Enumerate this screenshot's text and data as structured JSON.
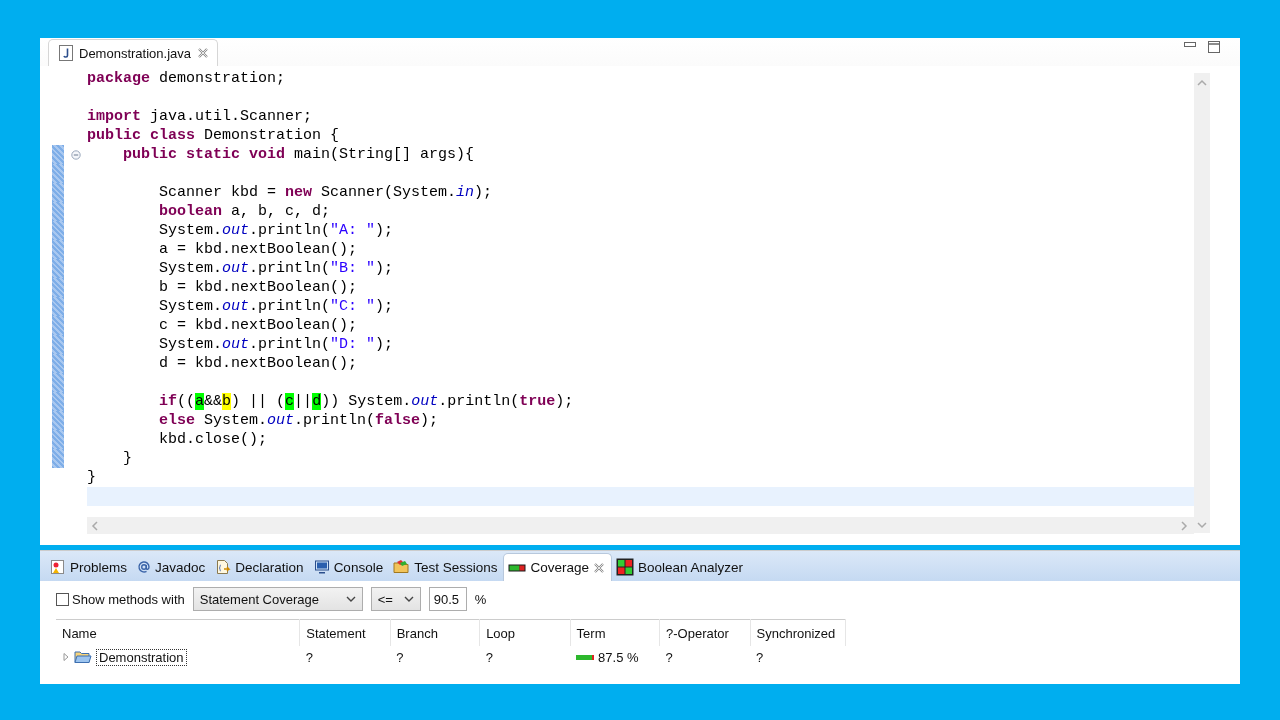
{
  "editor": {
    "tab": {
      "title": "Demonstration.java",
      "selected": true
    },
    "lines": [
      {
        "marked": false,
        "tokens": [
          {
            "kind": "keyword",
            "text": "package"
          },
          {
            "kind": "plain",
            "text": " demonstration;"
          }
        ]
      },
      {
        "marked": false,
        "blank_before": true,
        "tokens": [
          {
            "kind": "keyword",
            "text": "import"
          },
          {
            "kind": "plain",
            "text": " java.util.Scanner;"
          }
        ]
      },
      {
        "marked": false,
        "tokens": [
          {
            "kind": "keyword",
            "text": "public class"
          },
          {
            "kind": "plain",
            "text": " Demonstration {"
          }
        ]
      },
      {
        "marked": true,
        "foldable": true,
        "tokens": [
          {
            "kind": "keyword",
            "text": "    public static void"
          },
          {
            "kind": "plain",
            "text": " main(String[] args){"
          }
        ]
      },
      {
        "marked": true
      },
      {
        "marked": true,
        "tokens": [
          {
            "kind": "plain",
            "text": "        Scanner kbd = "
          },
          {
            "kind": "keyword",
            "text": "new"
          },
          {
            "kind": "plain",
            "text": " Scanner(System."
          },
          {
            "kind": "field",
            "text": "in"
          },
          {
            "kind": "plain",
            "text": ");"
          }
        ]
      },
      {
        "marked": true,
        "tokens": [
          {
            "kind": "keyword",
            "text": "        boolean"
          },
          {
            "kind": "plain",
            "text": " a, b, c, d;"
          }
        ]
      },
      {
        "marked": true,
        "tokens": [
          {
            "kind": "plain",
            "text": "        System."
          },
          {
            "kind": "field",
            "text": "out"
          },
          {
            "kind": "plain",
            "text": ".println("
          },
          {
            "kind": "string",
            "text": "\"A: \""
          },
          {
            "kind": "plain",
            "text": ");"
          }
        ]
      },
      {
        "marked": true,
        "tokens": [
          {
            "kind": "plain",
            "text": "        a = kbd.nextBoolean();"
          }
        ]
      },
      {
        "marked": true,
        "tokens": [
          {
            "kind": "plain",
            "text": "        System."
          },
          {
            "kind": "field",
            "text": "out"
          },
          {
            "kind": "plain",
            "text": ".println("
          },
          {
            "kind": "string",
            "text": "\"B: \""
          },
          {
            "kind": "plain",
            "text": ");"
          }
        ]
      },
      {
        "marked": true,
        "tokens": [
          {
            "kind": "plain",
            "text": "        b = kbd.nextBoolean();"
          }
        ]
      },
      {
        "marked": true,
        "tokens": [
          {
            "kind": "plain",
            "text": "        System."
          },
          {
            "kind": "field",
            "text": "out"
          },
          {
            "kind": "plain",
            "text": ".println("
          },
          {
            "kind": "string",
            "text": "\"C: \""
          },
          {
            "kind": "plain",
            "text": ");"
          }
        ]
      },
      {
        "marked": true,
        "tokens": [
          {
            "kind": "plain",
            "text": "        c = kbd.nextBoolean();"
          }
        ]
      },
      {
        "marked": true,
        "tokens": [
          {
            "kind": "plain",
            "text": "        System."
          },
          {
            "kind": "field",
            "text": "out"
          },
          {
            "kind": "plain",
            "text": ".println("
          },
          {
            "kind": "string",
            "text": "\"D: \""
          },
          {
            "kind": "plain",
            "text": ");"
          }
        ]
      },
      {
        "marked": true,
        "tokens": [
          {
            "kind": "plain",
            "text": "        d = kbd.nextBoolean();"
          }
        ]
      },
      {
        "marked": true
      },
      {
        "marked": true,
        "tokens": [
          {
            "kind": "keyword",
            "text": "        if"
          },
          {
            "kind": "plain",
            "text": "(("
          },
          {
            "kind": "plain",
            "text": "a",
            "color": "#00ff00"
          },
          {
            "kind": "plain",
            "text": "&&"
          },
          {
            "kind": "plain",
            "text": "b",
            "color": "#ffff00"
          },
          {
            "kind": "plain",
            "text": ") || ("
          },
          {
            "kind": "plain",
            "text": "c",
            "color": "#00ff00"
          },
          {
            "kind": "plain",
            "text": "||"
          },
          {
            "kind": "plain",
            "text": "d",
            "color": "#00ff00"
          },
          {
            "kind": "plain",
            "text": ")) System."
          },
          {
            "kind": "field",
            "text": "out"
          },
          {
            "kind": "plain",
            "text": ".println("
          },
          {
            "kind": "keyword",
            "text": "true"
          },
          {
            "kind": "plain",
            "text": ");"
          }
        ]
      },
      {
        "marked": true,
        "tokens": [
          {
            "kind": "keyword",
            "text": "        else"
          },
          {
            "kind": "plain",
            "text": " System."
          },
          {
            "kind": "field",
            "text": "out"
          },
          {
            "kind": "plain",
            "text": ".println("
          },
          {
            "kind": "keyword",
            "text": "false"
          },
          {
            "kind": "plain",
            "text": ");"
          }
        ]
      },
      {
        "marked": true,
        "tokens": [
          {
            "kind": "plain",
            "text": "        kbd.close();"
          }
        ]
      },
      {
        "marked": true,
        "tokens": [
          {
            "kind": "plain",
            "text": "    }"
          }
        ]
      },
      {
        "marked": false,
        "tokens": [
          {
            "kind": "plain",
            "text": "}"
          }
        ]
      },
      {
        "marked": false,
        "current": true
      }
    ]
  },
  "panel": {
    "tabs": [
      {
        "kind": "problems",
        "label": "Problems",
        "selected": false
      },
      {
        "kind": "javadoc",
        "label": "Javadoc",
        "selected": false
      },
      {
        "kind": "declaration",
        "label": "Declaration",
        "selected": false
      },
      {
        "kind": "console",
        "label": "Console",
        "selected": false
      },
      {
        "kind": "test-sessions",
        "label": "Test Sessions",
        "selected": false
      },
      {
        "kind": "coverage",
        "label": "Coverage",
        "selected": true
      },
      {
        "kind": "boolean-analyzer",
        "label": "Boolean Analyzer",
        "selected": false
      }
    ],
    "filter": {
      "checked": false,
      "label": "Show methods with",
      "metric": "Statement Coverage",
      "operator": "<=",
      "threshold": "90.5",
      "unit": "%"
    },
    "table": {
      "columns": [
        "Name",
        "Statement",
        "Branch",
        "Loop",
        "Term",
        "?-Operator",
        "Synchronized"
      ],
      "rows": [
        {
          "expanded": false,
          "cells": [
            {
              "text": "Demonstration"
            },
            {
              "text": "?"
            },
            {
              "text": "?"
            },
            {
              "text": "?"
            },
            {
              "text": "87.5 %",
              "level": 0.875
            },
            {
              "text": "?"
            },
            {
              "text": "?"
            }
          ]
        }
      ]
    }
  }
}
